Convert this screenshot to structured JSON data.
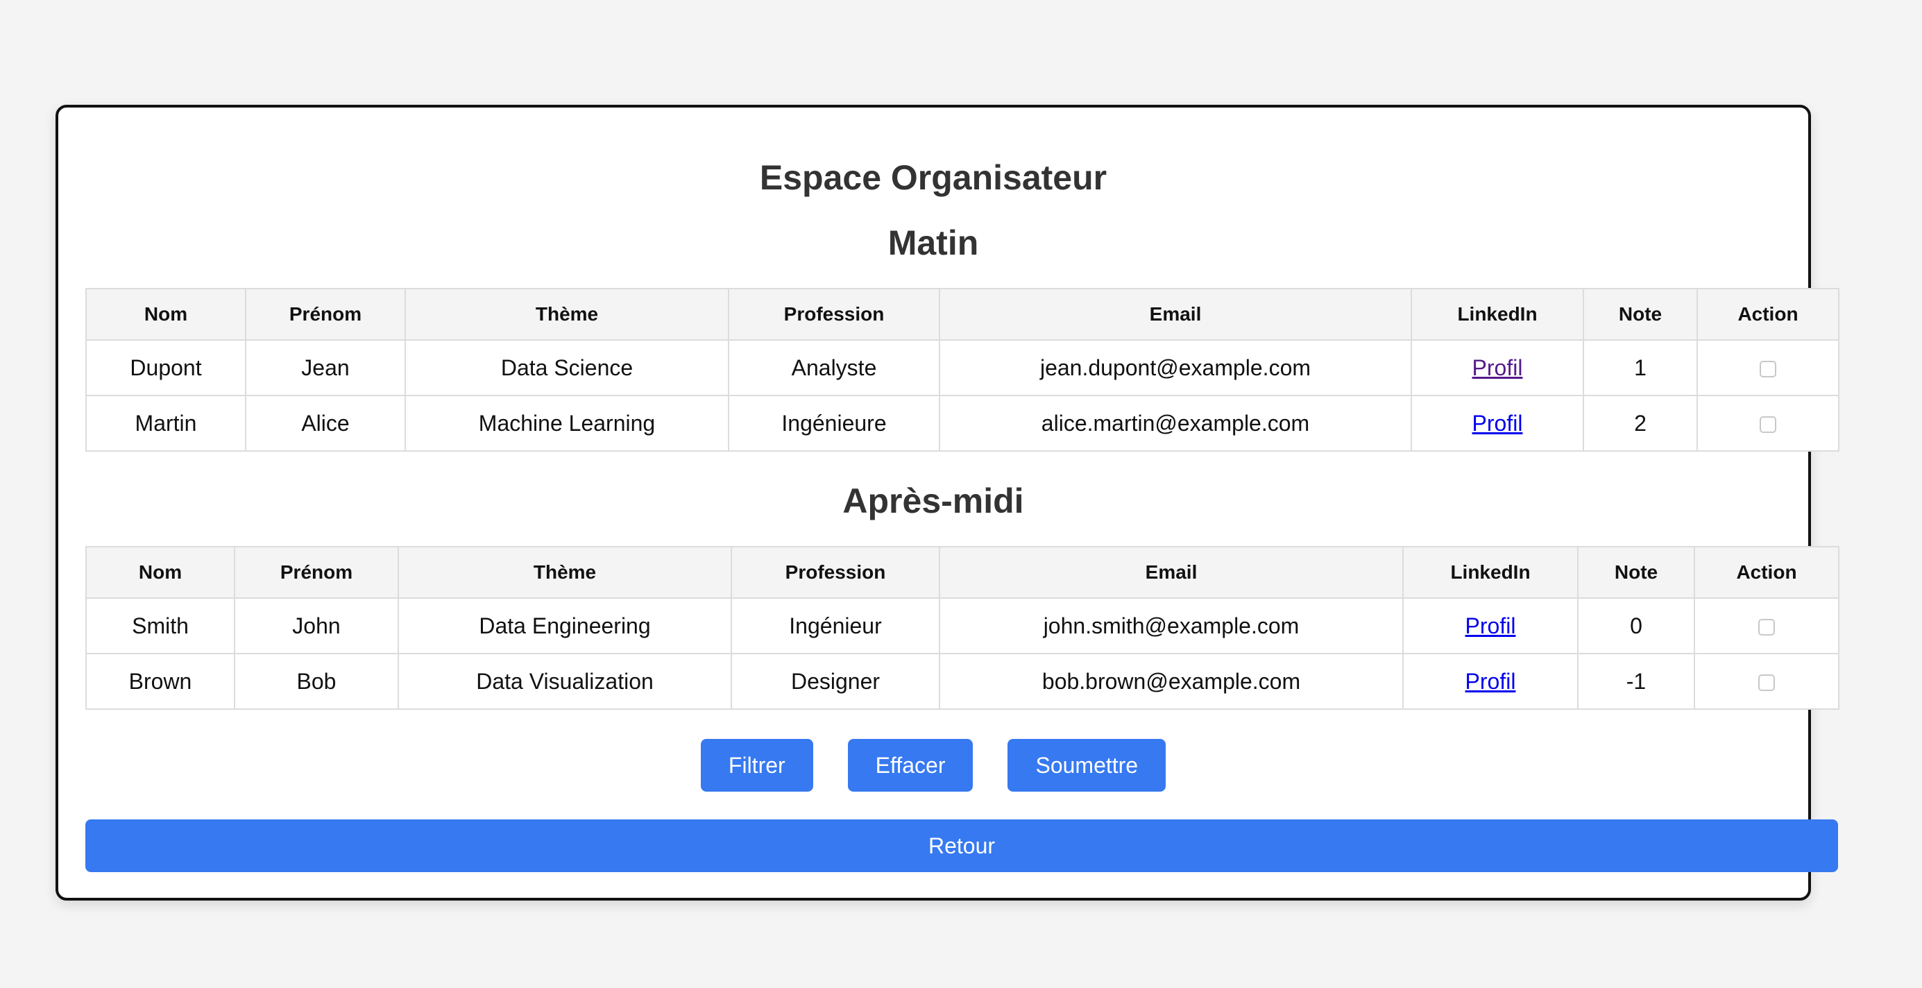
{
  "page": {
    "title": "Espace Organisateur"
  },
  "columns": [
    "Nom",
    "Prénom",
    "Thème",
    "Profession",
    "Email",
    "LinkedIn",
    "Note",
    "Action"
  ],
  "matin": {
    "title": "Matin",
    "rows": [
      {
        "nom": "Dupont",
        "prenom": "Jean",
        "theme": "Data Science",
        "profession": "Analyste",
        "email": "jean.dupont@example.com",
        "linkedin": "Profil",
        "note": "1",
        "action_checked": false
      },
      {
        "nom": "Martin",
        "prenom": "Alice",
        "theme": "Machine Learning",
        "profession": "Ingénieure",
        "email": "alice.martin@example.com",
        "linkedin": "Profil",
        "note": "2",
        "action_checked": false
      }
    ]
  },
  "apres_midi": {
    "title": "Après-midi",
    "rows": [
      {
        "nom": "Smith",
        "prenom": "John",
        "theme": "Data Engineering",
        "profession": "Ingénieur",
        "email": "john.smith@example.com",
        "linkedin": "Profil",
        "note": "0",
        "action_checked": false
      },
      {
        "nom": "Brown",
        "prenom": "Bob",
        "theme": "Data Visualization",
        "profession": "Designer",
        "email": "bob.brown@example.com",
        "linkedin": "Profil",
        "note": "-1",
        "action_checked": false
      }
    ]
  },
  "buttons": {
    "filtrer": "Filtrer",
    "effacer": "Effacer",
    "soumettre": "Soumettre",
    "retour": "Retour"
  },
  "colors": {
    "button": "#3679f0",
    "link": "#0000ee",
    "link_visited": "#551a8b",
    "title": "#333333",
    "header_bg": "#f4f4f4"
  }
}
